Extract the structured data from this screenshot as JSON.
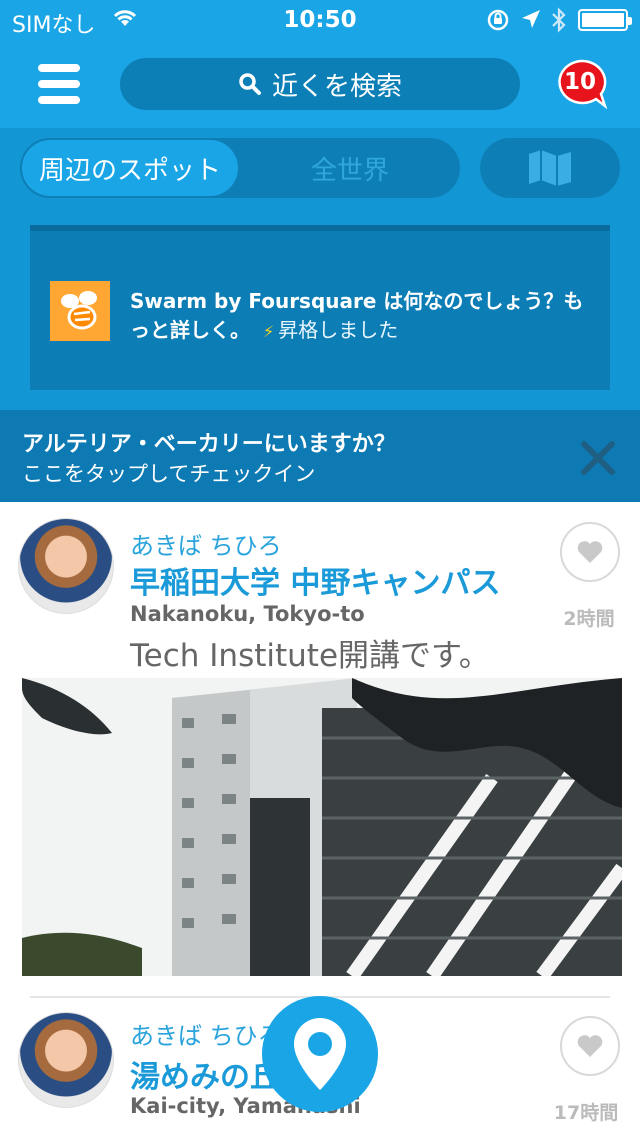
{
  "status_bar": {
    "carrier": "SIMなし",
    "time": "10:50"
  },
  "header": {
    "search_placeholder": "近くを検索",
    "notification_count": "10"
  },
  "tabs": {
    "nearby": "周辺のスポット",
    "worldwide": "全世界"
  },
  "promo": {
    "text": "Swarm by Foursquare は何なのでしょう？もっと詳しく。",
    "upgrade": "昇格しました"
  },
  "checkin_prompt": {
    "title": "アルテリア・ベーカリーにいますか？",
    "subtitle": "ここをタップしてチェックイン"
  },
  "feed": [
    {
      "user": "あきば ちひろ",
      "venue": "早稲田大学 中野キャンパス",
      "location": "Nakanoku, Tokyo-to",
      "time": "2時間",
      "shout": "Tech Institute開講です。"
    },
    {
      "user": "あきば ちひろ",
      "venue": "湯めみの丘",
      "location": "Kai-city, Yamanashi",
      "time": "17時間"
    }
  ],
  "colors": {
    "brand_blue": "#1aa6e6",
    "dark_blue": "#0e7ab3",
    "badge_red": "#e8141c"
  }
}
